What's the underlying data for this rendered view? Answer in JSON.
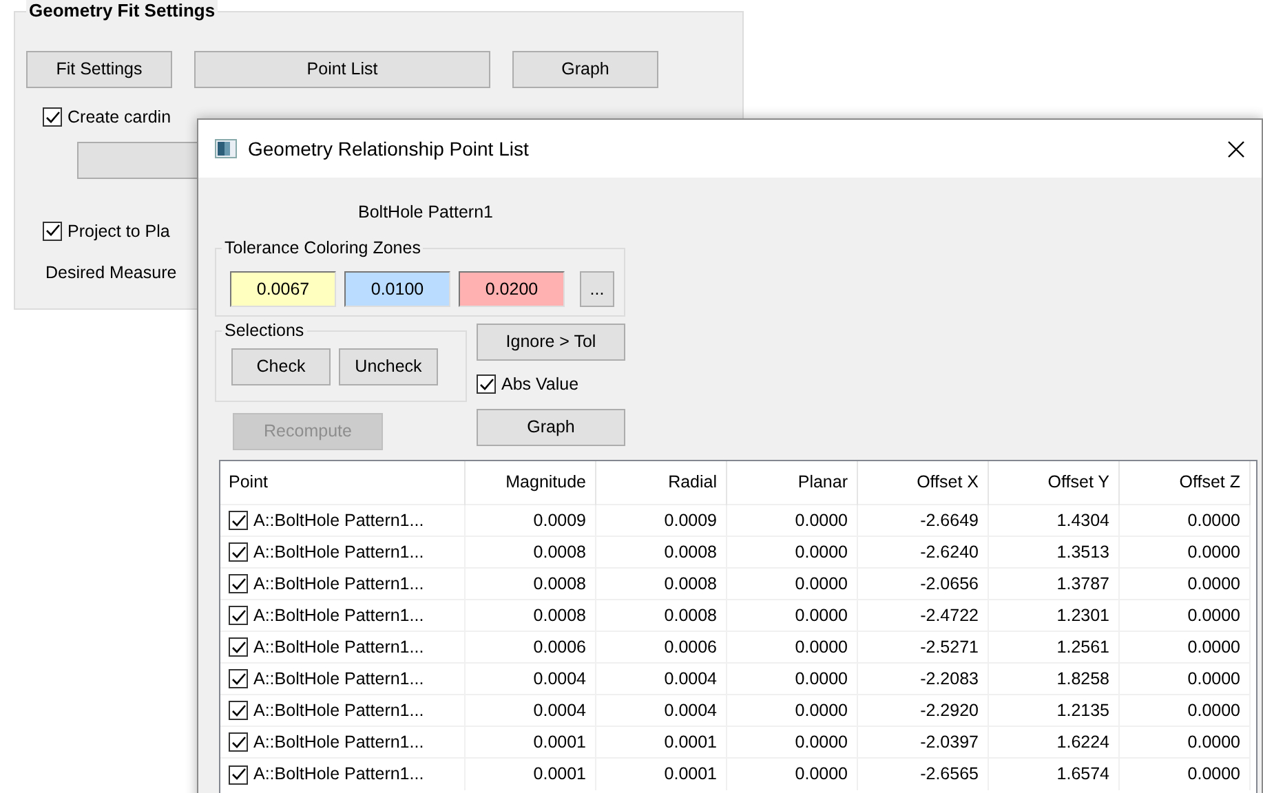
{
  "background_panel": {
    "title": "Geometry Fit Settings",
    "buttons": [
      "Fit Settings",
      "Point List",
      "Graph"
    ],
    "checkboxes": [
      {
        "label": "Create cardin",
        "checked": true
      },
      {
        "label": "Project to Pla",
        "checked": true
      }
    ],
    "label": "Desired Measure"
  },
  "dialog": {
    "title": "Geometry Relationship Point List",
    "feature": "BoltHole Pattern1",
    "tolerance": {
      "title": "Tolerance Coloring Zones",
      "zones": [
        {
          "value": "0.0067",
          "color": "#ffffc0"
        },
        {
          "value": "0.0100",
          "color": "#b9dcff"
        },
        {
          "value": "0.0200",
          "color": "#ffb0b0"
        }
      ],
      "more_button": "..."
    },
    "selections": {
      "title": "Selections",
      "buttons": [
        "Check",
        "Uncheck"
      ]
    },
    "ignore_button": "Ignore > Tol",
    "abs_value": {
      "label": "Abs Value",
      "checked": true
    },
    "recompute": {
      "label": "Recompute",
      "disabled": true
    },
    "graph_button": "Graph",
    "table": {
      "columns": [
        "Point",
        "Magnitude",
        "Radial",
        "Planar",
        "Offset X",
        "Offset Y",
        "Offset Z"
      ],
      "rows": [
        {
          "checked": true,
          "cells": [
            "A::BoltHole Pattern1...",
            "0.0009",
            "0.0009",
            "0.0000",
            "-2.6649",
            "1.4304",
            "0.0000"
          ]
        },
        {
          "checked": true,
          "cells": [
            "A::BoltHole Pattern1...",
            "0.0008",
            "0.0008",
            "0.0000",
            "-2.6240",
            "1.3513",
            "0.0000"
          ]
        },
        {
          "checked": true,
          "cells": [
            "A::BoltHole Pattern1...",
            "0.0008",
            "0.0008",
            "0.0000",
            "-2.0656",
            "1.3787",
            "0.0000"
          ]
        },
        {
          "checked": true,
          "cells": [
            "A::BoltHole Pattern1...",
            "0.0008",
            "0.0008",
            "0.0000",
            "-2.4722",
            "1.2301",
            "0.0000"
          ]
        },
        {
          "checked": true,
          "cells": [
            "A::BoltHole Pattern1...",
            "0.0006",
            "0.0006",
            "0.0000",
            "-2.5271",
            "1.2561",
            "0.0000"
          ]
        },
        {
          "checked": true,
          "cells": [
            "A::BoltHole Pattern1...",
            "0.0004",
            "0.0004",
            "0.0000",
            "-2.2083",
            "1.8258",
            "0.0000"
          ]
        },
        {
          "checked": true,
          "cells": [
            "A::BoltHole Pattern1...",
            "0.0004",
            "0.0004",
            "0.0000",
            "-2.2920",
            "1.2135",
            "0.0000"
          ]
        },
        {
          "checked": true,
          "cells": [
            "A::BoltHole Pattern1...",
            "0.0001",
            "0.0001",
            "0.0000",
            "-2.0397",
            "1.6224",
            "0.0000"
          ]
        },
        {
          "checked": true,
          "cells": [
            "A::BoltHole Pattern1...",
            "0.0001",
            "0.0001",
            "0.0000",
            "-2.6565",
            "1.6574",
            "0.0000"
          ]
        }
      ]
    }
  }
}
